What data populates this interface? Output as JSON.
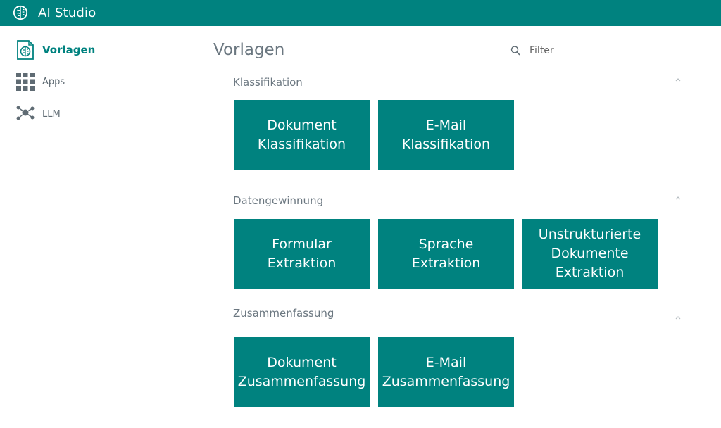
{
  "app": {
    "title": "AI Studio"
  },
  "sidebar": {
    "items": [
      {
        "label": "Vorlagen",
        "icon": "document-brain-icon",
        "active": true
      },
      {
        "label": "Apps",
        "icon": "grid-icon"
      },
      {
        "label": "LLM",
        "icon": "network-icon"
      }
    ]
  },
  "main": {
    "title": "Vorlagen",
    "filter": {
      "placeholder": "Filter",
      "value": ""
    },
    "sections": [
      {
        "title": "Klassifikation",
        "tiles": [
          "Dokument\nKlassifikation",
          "E-Mail\nKlassifikation"
        ]
      },
      {
        "title": "Datengewinnung",
        "tiles": [
          "Formular\nExtraktion",
          "Sprache\nExtraktion",
          "Unstrukturierte\nDokumente\nExtraktion"
        ]
      },
      {
        "title": "Zusammenfassung",
        "tiles": [
          "Dokument\nZusammenfassung",
          "E-Mail\nZusammenfassung"
        ]
      }
    ]
  },
  "colors": {
    "brand": "#00827f",
    "text": "#6b7780"
  }
}
